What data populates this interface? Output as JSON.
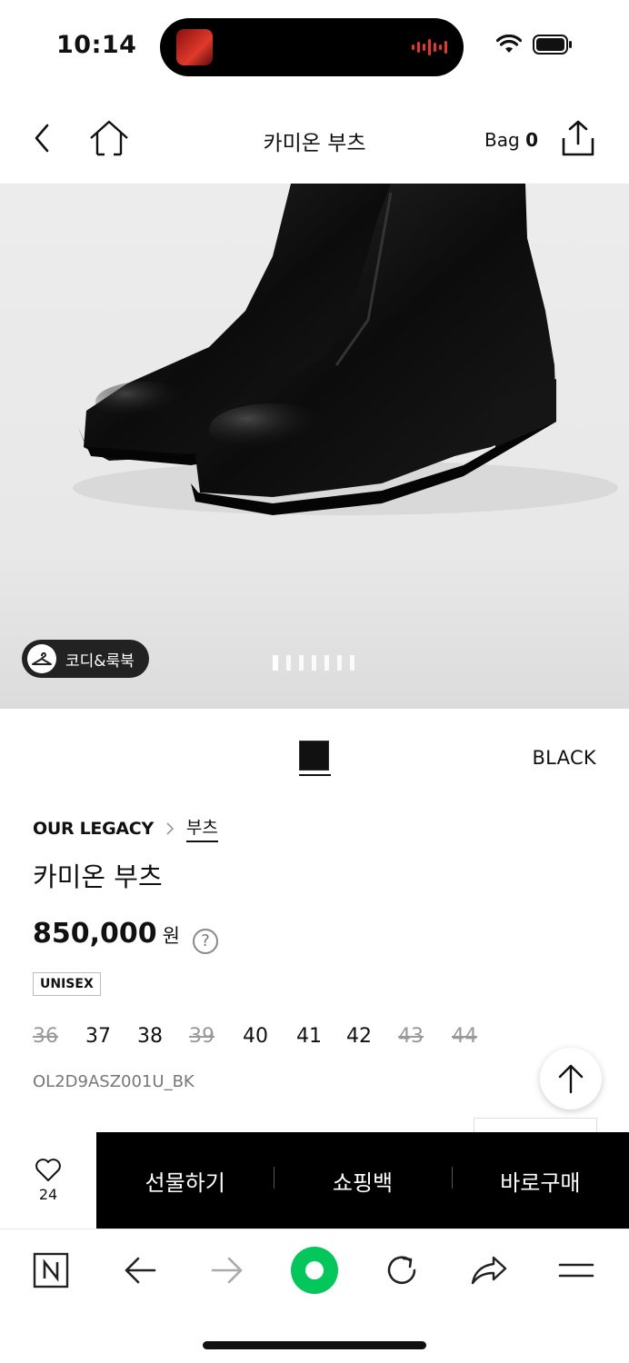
{
  "status_bar": {
    "time": "10:14"
  },
  "header": {
    "title": "카미온 부츠",
    "bag_label": "Bag",
    "bag_count": "0"
  },
  "gallery": {
    "badge_label": "코디&룩북",
    "slide_count": 7,
    "active_slide": 1
  },
  "product": {
    "color_hex": "#111111",
    "color_name": "BLACK",
    "brand": "OUR LEGACY",
    "category": "부츠",
    "name": "카미온 부츠",
    "price": "850,000",
    "currency": "원",
    "help_symbol": "?",
    "gender_tag": "UNISEX",
    "sizes": [
      {
        "label": "36",
        "available": false
      },
      {
        "label": "37",
        "available": true
      },
      {
        "label": "38",
        "available": true
      },
      {
        "label": "39",
        "available": false
      },
      {
        "label": "40",
        "available": true
      },
      {
        "label": "41",
        "available": true
      },
      {
        "label": "42",
        "available": true
      },
      {
        "label": "43",
        "available": false
      },
      {
        "label": "44",
        "available": false
      }
    ],
    "sku": "OL2D9ASZ001U_BK"
  },
  "actions": {
    "like_count": "24",
    "gift_label": "선물하기",
    "cart_label": "쇼핑백",
    "buy_label": "바로구매"
  },
  "browser": {
    "items": [
      "naver-home-icon",
      "back-arrow-icon",
      "forward-arrow-icon",
      "green-dot-icon",
      "reload-icon",
      "share-icon",
      "menu-icon"
    ],
    "accent_color": "#03C75A"
  }
}
